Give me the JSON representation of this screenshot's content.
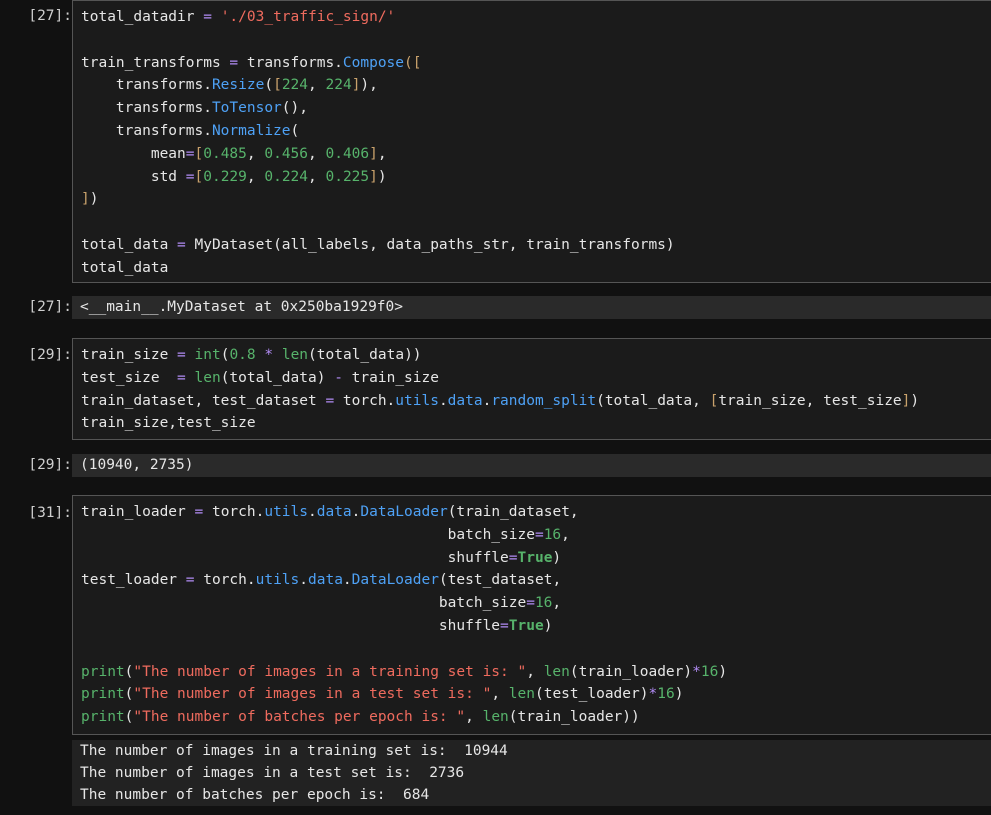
{
  "cells": [
    {
      "prompt": "[27]:",
      "code": [
        "total_datadir = './03_traffic_sign/'",
        "",
        "train_transforms = transforms.Compose([",
        "    transforms.Resize([224, 224]),",
        "    transforms.ToTensor(),",
        "    transforms.Normalize(",
        "        mean=[0.485, 0.456, 0.406],",
        "        std =[0.229, 0.224, 0.225])",
        "])",
        "",
        "total_data = MyDataset(all_labels, data_paths_str, train_transforms)",
        "total_data"
      ],
      "out_prompt": "[27]:",
      "output": "<__main__.MyDataset at 0x250ba1929f0>"
    },
    {
      "prompt": "[29]:",
      "code": [
        "train_size = int(0.8 * len(total_data))",
        "test_size  = len(total_data) - train_size",
        "train_dataset, test_dataset = torch.utils.data.random_split(total_data, [train_size, test_size])",
        "train_size,test_size"
      ],
      "out_prompt": "[29]:",
      "output": "(10940, 2735)"
    },
    {
      "prompt": "[31]:",
      "code": [
        "train_loader = torch.utils.data.DataLoader(train_dataset,",
        "                                          batch_size=16,",
        "                                          shuffle=True)",
        "test_loader = torch.utils.data.DataLoader(test_dataset,",
        "                                         batch_size=16,",
        "                                         shuffle=True)",
        "",
        "print(\"The number of images in a training set is: \", len(train_loader)*16)",
        "print(\"The number of images in a test set is: \", len(test_loader)*16)",
        "print(\"The number of batches per epoch is: \", len(train_loader))"
      ],
      "stream": [
        "The number of images in a training set is:  10944",
        "The number of images in a test set is:  2736",
        "The number of batches per epoch is:  684"
      ]
    }
  ]
}
